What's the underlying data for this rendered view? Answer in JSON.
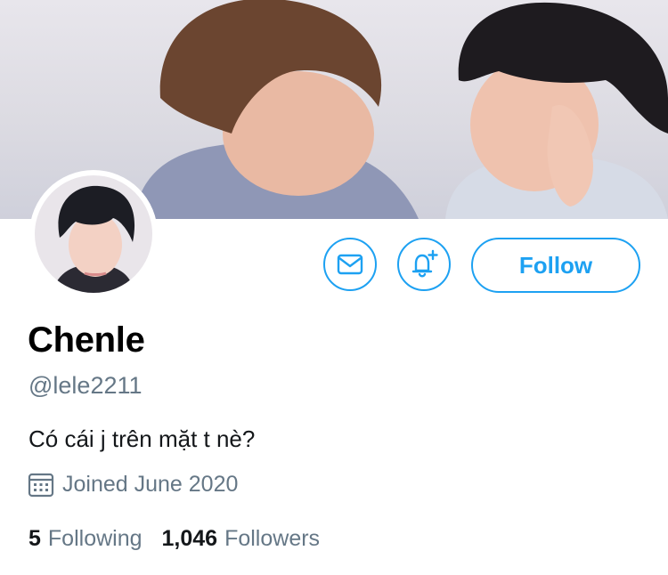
{
  "profile": {
    "display_name": "Chenle",
    "handle": "@lele2211",
    "bio": "Có cái j trên mặt t nè?",
    "joined": "Joined June 2020"
  },
  "actions": {
    "follow_label": "Follow"
  },
  "stats": {
    "following_count": "5",
    "following_label": "Following",
    "followers_count": "1,046",
    "followers_label": "Followers"
  },
  "icons": {
    "message": "envelope-icon",
    "notifications": "bell-plus-icon",
    "joined": "calendar-icon"
  },
  "colors": {
    "accent": "#1da1f2",
    "secondary_text": "#657786",
    "primary_text": "#14171a"
  }
}
